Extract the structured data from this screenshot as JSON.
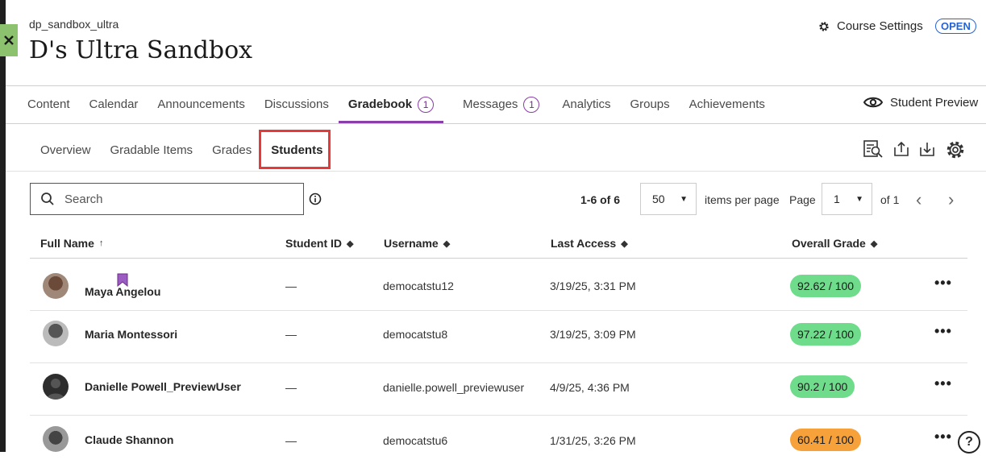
{
  "course": {
    "code": "dp_sandbox_ultra",
    "title": "D's Ultra Sandbox",
    "status_badge": "OPEN",
    "settings_label": "Course Settings"
  },
  "main_tabs": [
    {
      "label": "Content"
    },
    {
      "label": "Calendar"
    },
    {
      "label": "Announcements"
    },
    {
      "label": "Discussions"
    },
    {
      "label": "Gradebook",
      "count": "1",
      "active": true
    },
    {
      "label": "Messages",
      "count": "1"
    },
    {
      "label": "Analytics"
    },
    {
      "label": "Groups"
    },
    {
      "label": "Achievements"
    }
  ],
  "student_preview_label": "Student Preview",
  "sub_tabs": [
    {
      "label": "Overview"
    },
    {
      "label": "Gradable Items"
    },
    {
      "label": "Grades"
    },
    {
      "label": "Students",
      "active": true
    }
  ],
  "toolbar_icons": [
    "search-report-icon",
    "upload-icon",
    "download-icon",
    "gear-icon"
  ],
  "search": {
    "placeholder": "Search",
    "value": ""
  },
  "pagination": {
    "range": "1-6 of 6",
    "per_page": "50",
    "per_page_label": "items per page",
    "page_label": "Page",
    "page": "1",
    "of_label": "of 1"
  },
  "columns": {
    "full_name": "Full Name",
    "student_id": "Student ID",
    "username": "Username",
    "last_access": "Last Access",
    "overall_grade": "Overall Grade"
  },
  "students": [
    {
      "name": "Maya Angelou",
      "student_id": "—",
      "username": "democatstu12",
      "last_access": "3/19/25, 3:31 PM",
      "grade": "92.62 / 100",
      "grade_color": "#6fdc8c",
      "bookmarked": true
    },
    {
      "name": "Maria Montessori",
      "student_id": "—",
      "username": "democatstu8",
      "last_access": "3/19/25, 3:09 PM",
      "grade": "97.22 / 100",
      "grade_color": "#6fdc8c"
    },
    {
      "name": "Danielle Powell_PreviewUser",
      "student_id": "—",
      "username": "danielle.powell_previewuser",
      "last_access": "4/9/25, 4:36 PM",
      "grade": "90.2 / 100",
      "grade_color": "#6fdc8c"
    },
    {
      "name": "Claude Shannon",
      "student_id": "—",
      "username": "democatstu6",
      "last_access": "1/31/25, 3:26 PM",
      "grade": "60.41 / 100",
      "grade_color": "#f6a13a"
    }
  ],
  "colors": {
    "accent": "#8a3fa8",
    "highlight": "#e53a3a",
    "link": "#2563d6"
  }
}
